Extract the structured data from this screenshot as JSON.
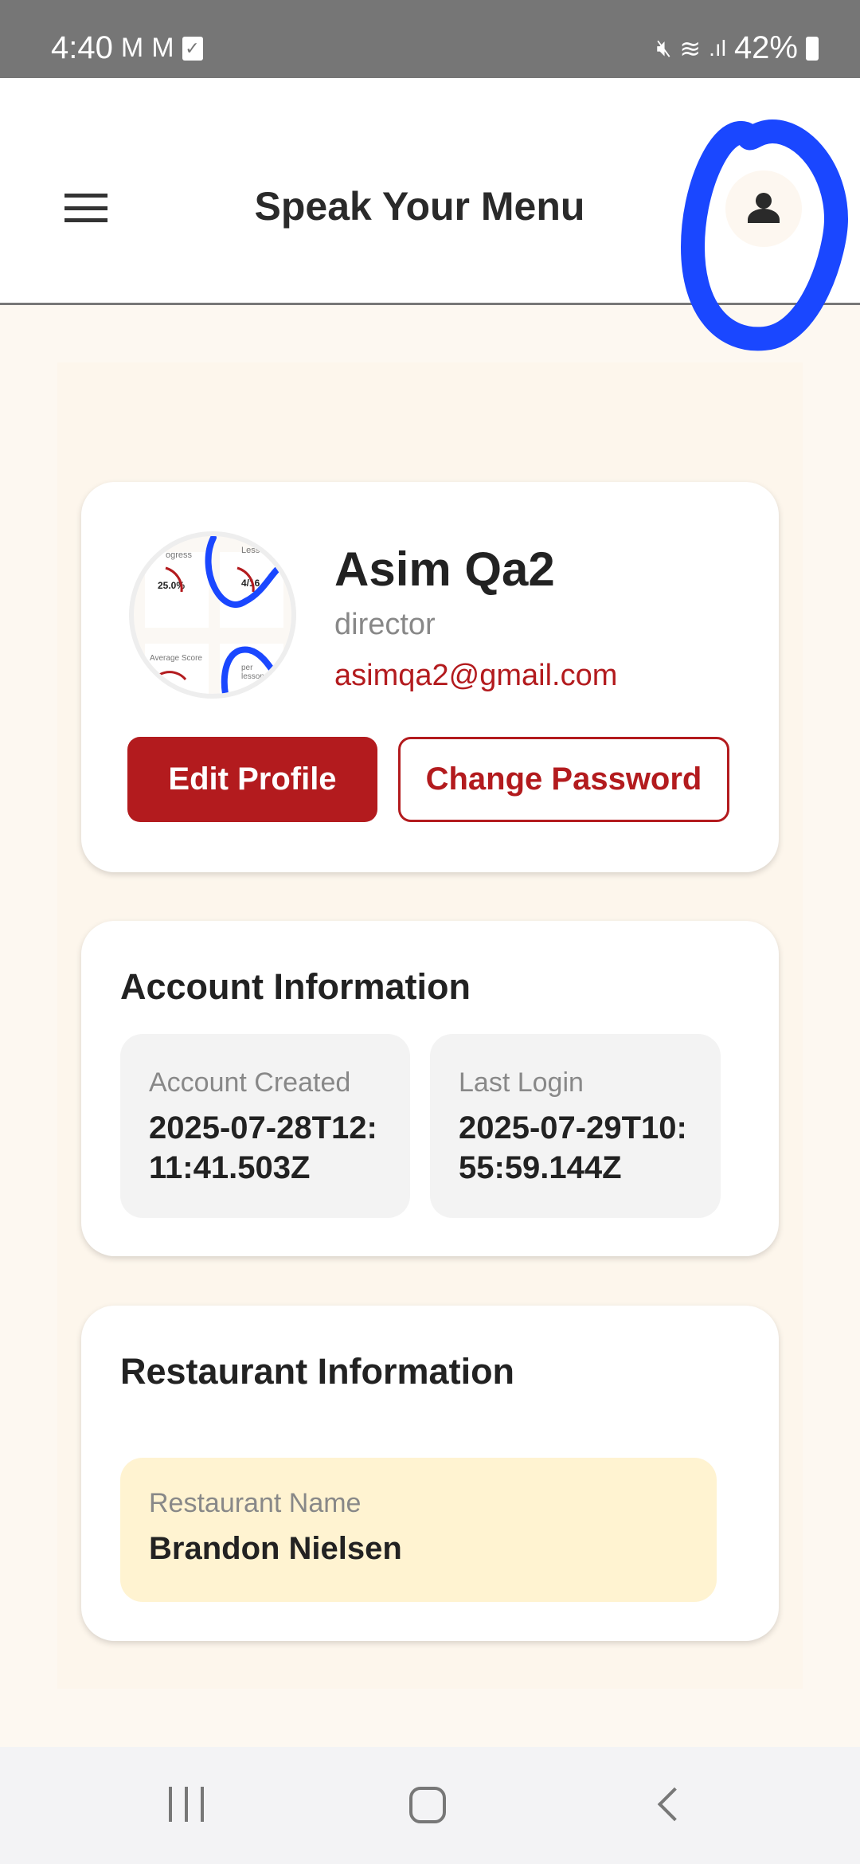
{
  "status_bar": {
    "time": "4:40",
    "notification_icons": [
      "gmail-icon",
      "gmail-icon",
      "task-check-icon"
    ],
    "battery": "42%"
  },
  "header": {
    "title": "Speak Your Menu",
    "menu_icon": "hamburger-icon",
    "profile_icon": "person-icon"
  },
  "profile": {
    "name": "Asim Qa2",
    "role": "director",
    "email": "asimqa2@gmail.com",
    "avatar_texts": {
      "progress_label": "ogress",
      "progress_value": "25.0%",
      "lessons_label": "Lesso",
      "lessons_value": "4/16",
      "avg_label": "Average Score",
      "per_lesson": "per lesson",
      "aver": "Aver"
    },
    "edit_label": "Edit Profile",
    "change_password_label": "Change Password"
  },
  "account": {
    "title": "Account Information",
    "created_label": "Account Created",
    "created_value": "2025-07-28T12:11:41.503Z",
    "last_login_label": "Last Login",
    "last_login_value": "2025-07-29T10:55:59.144Z"
  },
  "restaurant": {
    "title": "Restaurant Information",
    "name_label": "Restaurant Name",
    "name_value": "Brandon Nielsen"
  },
  "colors": {
    "accent": "#b31b1e",
    "annotation": "#1a47ff",
    "restaurant_box": "#fff3d1"
  }
}
